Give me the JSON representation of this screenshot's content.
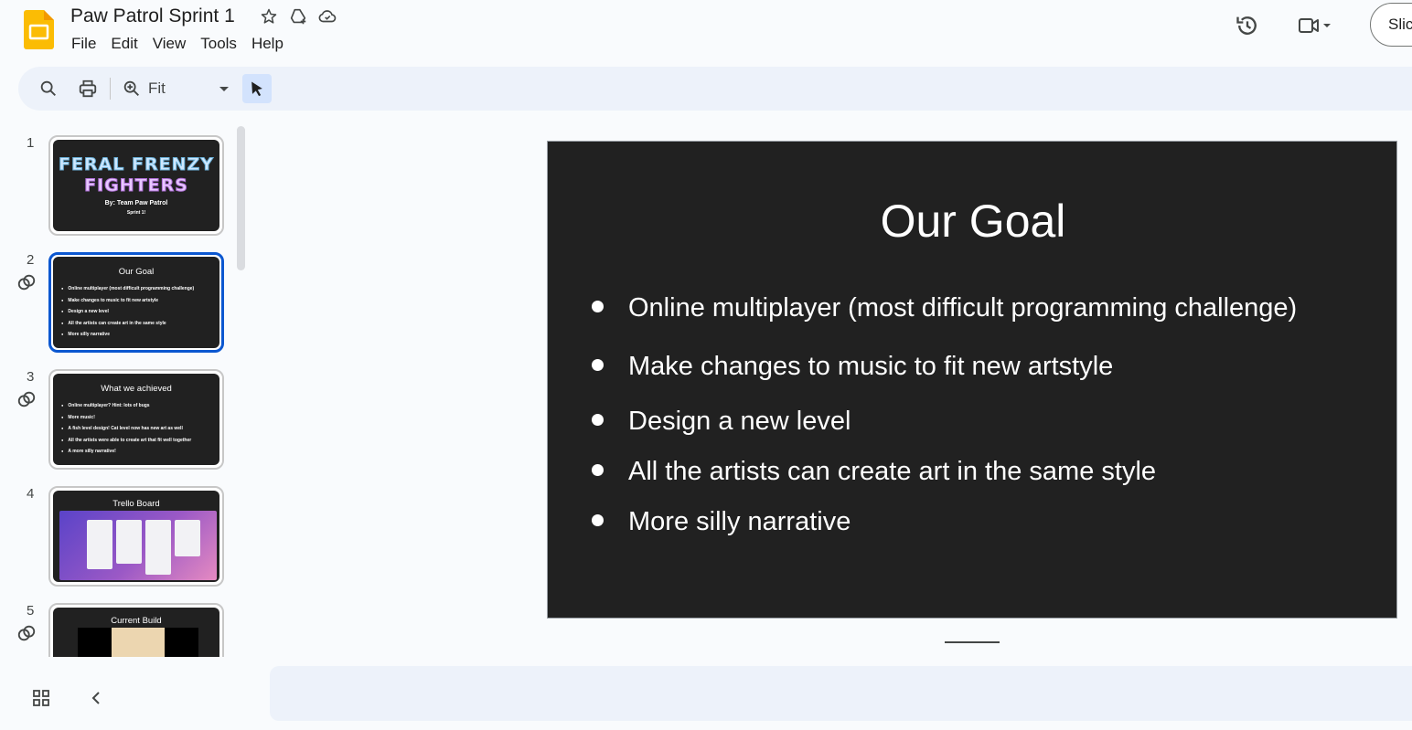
{
  "app": {
    "doc_title": "Paw Patrol Sprint 1",
    "menu": [
      "File",
      "Edit",
      "View",
      "Tools",
      "Help"
    ],
    "slideshow_label": "Slic",
    "colors": {
      "accent": "#0b57d0",
      "logo": "#fbbc04",
      "slide_bg": "#212121"
    }
  },
  "toolbar": {
    "zoom_value": "Fit",
    "icons": [
      "search-icon",
      "print-icon",
      "zoom-icon",
      "select-cursor-icon"
    ]
  },
  "filmstrip": {
    "slides": [
      {
        "number": "1",
        "title_line1": "FERAL FRENZY",
        "title_line2": "FIGHTERS",
        "subtitle": "By: Team Paw Patrol",
        "subtitle2": "Sprint 1!"
      },
      {
        "number": "2",
        "title": "Our Goal",
        "bullets": [
          "Online multiplayer (most difficult programming challenge)",
          "Make changes to music to fit new artstyle",
          "Design a new level",
          "All the artists can create art in the same style",
          "More silly narrative"
        ]
      },
      {
        "number": "3",
        "title": "What we achieved",
        "bullets": [
          "Online multiplayer? Hint: lots of bugs",
          "More music!",
          "A fish level design! Cat level now has new art as well",
          "All the artists were able to create art that fit well together",
          "A more silly narrative!"
        ]
      },
      {
        "number": "4",
        "title": "Trello Board"
      },
      {
        "number": "5",
        "title": "Current Build"
      }
    ]
  },
  "slide": {
    "title": "Our Goal",
    "bullets": [
      "Online multiplayer (most difficult programming challenge)",
      "Make changes to music to fit new artstyle",
      "Design a new level",
      "All the artists can create art in the same style",
      "More silly narrative"
    ]
  }
}
